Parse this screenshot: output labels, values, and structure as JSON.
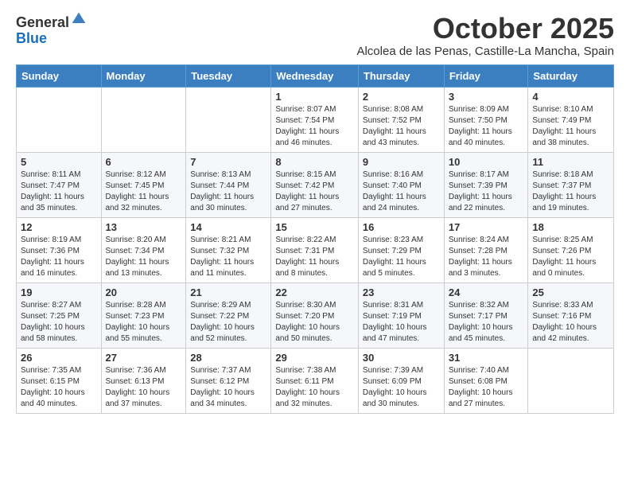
{
  "logo": {
    "general": "General",
    "blue": "Blue"
  },
  "title": "October 2025",
  "subtitle": "Alcolea de las Penas, Castille-La Mancha, Spain",
  "headers": [
    "Sunday",
    "Monday",
    "Tuesday",
    "Wednesday",
    "Thursday",
    "Friday",
    "Saturday"
  ],
  "weeks": [
    [
      {
        "day": "",
        "info": ""
      },
      {
        "day": "",
        "info": ""
      },
      {
        "day": "",
        "info": ""
      },
      {
        "day": "1",
        "info": "Sunrise: 8:07 AM\nSunset: 7:54 PM\nDaylight: 11 hours\nand 46 minutes."
      },
      {
        "day": "2",
        "info": "Sunrise: 8:08 AM\nSunset: 7:52 PM\nDaylight: 11 hours\nand 43 minutes."
      },
      {
        "day": "3",
        "info": "Sunrise: 8:09 AM\nSunset: 7:50 PM\nDaylight: 11 hours\nand 40 minutes."
      },
      {
        "day": "4",
        "info": "Sunrise: 8:10 AM\nSunset: 7:49 PM\nDaylight: 11 hours\nand 38 minutes."
      }
    ],
    [
      {
        "day": "5",
        "info": "Sunrise: 8:11 AM\nSunset: 7:47 PM\nDaylight: 11 hours\nand 35 minutes."
      },
      {
        "day": "6",
        "info": "Sunrise: 8:12 AM\nSunset: 7:45 PM\nDaylight: 11 hours\nand 32 minutes."
      },
      {
        "day": "7",
        "info": "Sunrise: 8:13 AM\nSunset: 7:44 PM\nDaylight: 11 hours\nand 30 minutes."
      },
      {
        "day": "8",
        "info": "Sunrise: 8:15 AM\nSunset: 7:42 PM\nDaylight: 11 hours\nand 27 minutes."
      },
      {
        "day": "9",
        "info": "Sunrise: 8:16 AM\nSunset: 7:40 PM\nDaylight: 11 hours\nand 24 minutes."
      },
      {
        "day": "10",
        "info": "Sunrise: 8:17 AM\nSunset: 7:39 PM\nDaylight: 11 hours\nand 22 minutes."
      },
      {
        "day": "11",
        "info": "Sunrise: 8:18 AM\nSunset: 7:37 PM\nDaylight: 11 hours\nand 19 minutes."
      }
    ],
    [
      {
        "day": "12",
        "info": "Sunrise: 8:19 AM\nSunset: 7:36 PM\nDaylight: 11 hours\nand 16 minutes."
      },
      {
        "day": "13",
        "info": "Sunrise: 8:20 AM\nSunset: 7:34 PM\nDaylight: 11 hours\nand 13 minutes."
      },
      {
        "day": "14",
        "info": "Sunrise: 8:21 AM\nSunset: 7:32 PM\nDaylight: 11 hours\nand 11 minutes."
      },
      {
        "day": "15",
        "info": "Sunrise: 8:22 AM\nSunset: 7:31 PM\nDaylight: 11 hours\nand 8 minutes."
      },
      {
        "day": "16",
        "info": "Sunrise: 8:23 AM\nSunset: 7:29 PM\nDaylight: 11 hours\nand 5 minutes."
      },
      {
        "day": "17",
        "info": "Sunrise: 8:24 AM\nSunset: 7:28 PM\nDaylight: 11 hours\nand 3 minutes."
      },
      {
        "day": "18",
        "info": "Sunrise: 8:25 AM\nSunset: 7:26 PM\nDaylight: 11 hours\nand 0 minutes."
      }
    ],
    [
      {
        "day": "19",
        "info": "Sunrise: 8:27 AM\nSunset: 7:25 PM\nDaylight: 10 hours\nand 58 minutes."
      },
      {
        "day": "20",
        "info": "Sunrise: 8:28 AM\nSunset: 7:23 PM\nDaylight: 10 hours\nand 55 minutes."
      },
      {
        "day": "21",
        "info": "Sunrise: 8:29 AM\nSunset: 7:22 PM\nDaylight: 10 hours\nand 52 minutes."
      },
      {
        "day": "22",
        "info": "Sunrise: 8:30 AM\nSunset: 7:20 PM\nDaylight: 10 hours\nand 50 minutes."
      },
      {
        "day": "23",
        "info": "Sunrise: 8:31 AM\nSunset: 7:19 PM\nDaylight: 10 hours\nand 47 minutes."
      },
      {
        "day": "24",
        "info": "Sunrise: 8:32 AM\nSunset: 7:17 PM\nDaylight: 10 hours\nand 45 minutes."
      },
      {
        "day": "25",
        "info": "Sunrise: 8:33 AM\nSunset: 7:16 PM\nDaylight: 10 hours\nand 42 minutes."
      }
    ],
    [
      {
        "day": "26",
        "info": "Sunrise: 7:35 AM\nSunset: 6:15 PM\nDaylight: 10 hours\nand 40 minutes."
      },
      {
        "day": "27",
        "info": "Sunrise: 7:36 AM\nSunset: 6:13 PM\nDaylight: 10 hours\nand 37 minutes."
      },
      {
        "day": "28",
        "info": "Sunrise: 7:37 AM\nSunset: 6:12 PM\nDaylight: 10 hours\nand 34 minutes."
      },
      {
        "day": "29",
        "info": "Sunrise: 7:38 AM\nSunset: 6:11 PM\nDaylight: 10 hours\nand 32 minutes."
      },
      {
        "day": "30",
        "info": "Sunrise: 7:39 AM\nSunset: 6:09 PM\nDaylight: 10 hours\nand 30 minutes."
      },
      {
        "day": "31",
        "info": "Sunrise: 7:40 AM\nSunset: 6:08 PM\nDaylight: 10 hours\nand 27 minutes."
      },
      {
        "day": "",
        "info": ""
      }
    ]
  ]
}
